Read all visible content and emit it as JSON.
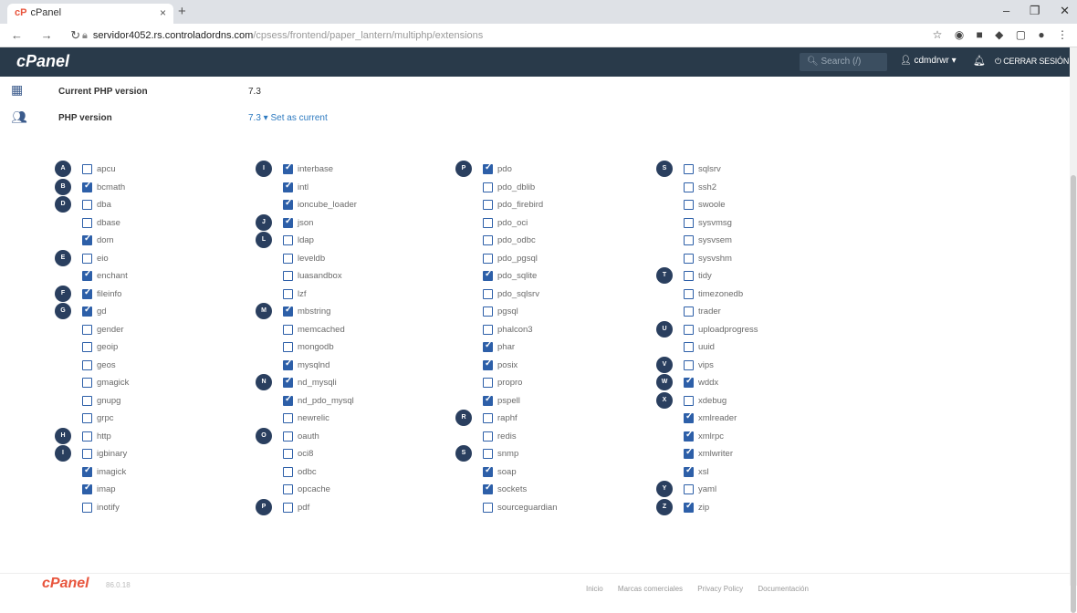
{
  "browser": {
    "tab_title": "cPanel",
    "url_host": "servidor4052.rs.controladordns.com",
    "url_rest": "/cpsess/frontend/paper_lantern/multiphp/extensions"
  },
  "header": {
    "logo": "cPanel",
    "search_placeholder": "Search (/)",
    "user": "cdmdrwr",
    "logout": "CERRAR SESIÓN"
  },
  "php": {
    "current_label": "Current PHP version",
    "current_value": "7.3",
    "version_label": "PHP version",
    "version_value": "7.3 ▾  Set as current"
  },
  "extensions": {
    "col1": [
      {
        "letter": "A",
        "name": "apcu",
        "on": false
      },
      {
        "letter": "B",
        "name": "bcmath",
        "on": true
      },
      {
        "letter": "D",
        "name": "dba",
        "on": false
      },
      {
        "letter": "",
        "name": "dbase",
        "on": false
      },
      {
        "letter": "",
        "name": "dom",
        "on": true
      },
      {
        "letter": "E",
        "name": "eio",
        "on": false
      },
      {
        "letter": "",
        "name": "enchant",
        "on": true
      },
      {
        "letter": "F",
        "name": "fileinfo",
        "on": true
      },
      {
        "letter": "G",
        "name": "gd",
        "on": true
      },
      {
        "letter": "",
        "name": "gender",
        "on": false
      },
      {
        "letter": "",
        "name": "geoip",
        "on": false
      },
      {
        "letter": "",
        "name": "geos",
        "on": false
      },
      {
        "letter": "",
        "name": "gmagick",
        "on": false
      },
      {
        "letter": "",
        "name": "gnupg",
        "on": false
      },
      {
        "letter": "",
        "name": "grpc",
        "on": false
      },
      {
        "letter": "H",
        "name": "http",
        "on": false
      },
      {
        "letter": "I",
        "name": "igbinary",
        "on": false
      },
      {
        "letter": "",
        "name": "imagick",
        "on": true
      },
      {
        "letter": "",
        "name": "imap",
        "on": true
      },
      {
        "letter": "",
        "name": "inotify",
        "on": false
      }
    ],
    "col2": [
      {
        "letter": "I",
        "name": "interbase",
        "on": true
      },
      {
        "letter": "",
        "name": "intl",
        "on": true
      },
      {
        "letter": "",
        "name": "ioncube_loader",
        "on": true
      },
      {
        "letter": "J",
        "name": "json",
        "on": true
      },
      {
        "letter": "L",
        "name": "ldap",
        "on": false
      },
      {
        "letter": "",
        "name": "leveldb",
        "on": false
      },
      {
        "letter": "",
        "name": "luasandbox",
        "on": false
      },
      {
        "letter": "",
        "name": "lzf",
        "on": false
      },
      {
        "letter": "M",
        "name": "mbstring",
        "on": true
      },
      {
        "letter": "",
        "name": "memcached",
        "on": false
      },
      {
        "letter": "",
        "name": "mongodb",
        "on": false
      },
      {
        "letter": "",
        "name": "mysqlnd",
        "on": true
      },
      {
        "letter": "N",
        "name": "nd_mysqli",
        "on": true
      },
      {
        "letter": "",
        "name": "nd_pdo_mysql",
        "on": true
      },
      {
        "letter": "",
        "name": "newrelic",
        "on": false
      },
      {
        "letter": "O",
        "name": "oauth",
        "on": false
      },
      {
        "letter": "",
        "name": "oci8",
        "on": false
      },
      {
        "letter": "",
        "name": "odbc",
        "on": false
      },
      {
        "letter": "",
        "name": "opcache",
        "on": false
      },
      {
        "letter": "P",
        "name": "pdf",
        "on": false
      }
    ],
    "col3": [
      {
        "letter": "P",
        "name": "pdo",
        "on": true
      },
      {
        "letter": "",
        "name": "pdo_dblib",
        "on": false
      },
      {
        "letter": "",
        "name": "pdo_firebird",
        "on": false
      },
      {
        "letter": "",
        "name": "pdo_oci",
        "on": false
      },
      {
        "letter": "",
        "name": "pdo_odbc",
        "on": false
      },
      {
        "letter": "",
        "name": "pdo_pgsql",
        "on": false
      },
      {
        "letter": "",
        "name": "pdo_sqlite",
        "on": true
      },
      {
        "letter": "",
        "name": "pdo_sqlsrv",
        "on": false
      },
      {
        "letter": "",
        "name": "pgsql",
        "on": false
      },
      {
        "letter": "",
        "name": "phalcon3",
        "on": false
      },
      {
        "letter": "",
        "name": "phar",
        "on": true
      },
      {
        "letter": "",
        "name": "posix",
        "on": true
      },
      {
        "letter": "",
        "name": "propro",
        "on": false
      },
      {
        "letter": "",
        "name": "pspell",
        "on": true
      },
      {
        "letter": "R",
        "name": "raphf",
        "on": false
      },
      {
        "letter": "",
        "name": "redis",
        "on": false
      },
      {
        "letter": "S",
        "name": "snmp",
        "on": false
      },
      {
        "letter": "",
        "name": "soap",
        "on": true
      },
      {
        "letter": "",
        "name": "sockets",
        "on": true
      },
      {
        "letter": "",
        "name": "sourceguardian",
        "on": false
      }
    ],
    "col4": [
      {
        "letter": "S",
        "name": "sqlsrv",
        "on": false
      },
      {
        "letter": "",
        "name": "ssh2",
        "on": false
      },
      {
        "letter": "",
        "name": "swoole",
        "on": false
      },
      {
        "letter": "",
        "name": "sysvmsg",
        "on": false
      },
      {
        "letter": "",
        "name": "sysvsem",
        "on": false
      },
      {
        "letter": "",
        "name": "sysvshm",
        "on": false
      },
      {
        "letter": "T",
        "name": "tidy",
        "on": false
      },
      {
        "letter": "",
        "name": "timezonedb",
        "on": false
      },
      {
        "letter": "",
        "name": "trader",
        "on": false
      },
      {
        "letter": "U",
        "name": "uploadprogress",
        "on": false
      },
      {
        "letter": "",
        "name": "uuid",
        "on": false
      },
      {
        "letter": "V",
        "name": "vips",
        "on": false
      },
      {
        "letter": "W",
        "name": "wddx",
        "on": true
      },
      {
        "letter": "X",
        "name": "xdebug",
        "on": false
      },
      {
        "letter": "",
        "name": "xmlreader",
        "on": true
      },
      {
        "letter": "",
        "name": "xmlrpc",
        "on": true
      },
      {
        "letter": "",
        "name": "xmlwriter",
        "on": true
      },
      {
        "letter": "",
        "name": "xsl",
        "on": true
      },
      {
        "letter": "Y",
        "name": "yaml",
        "on": false
      },
      {
        "letter": "Z",
        "name": "zip",
        "on": true
      }
    ]
  },
  "footer": {
    "logo": "cPanel",
    "version": "86.0.18",
    "links": [
      "Inicio",
      "Marcas comerciales",
      "Privacy Policy",
      "Documentación"
    ]
  }
}
